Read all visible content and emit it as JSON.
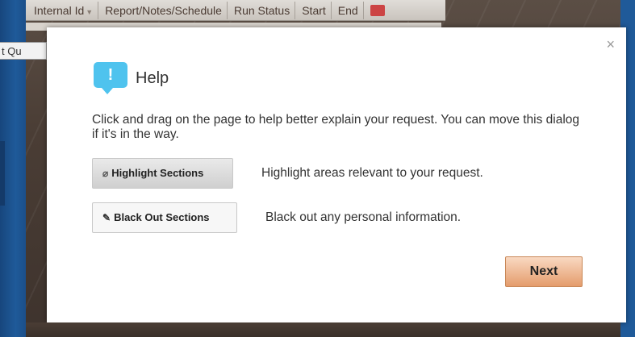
{
  "background": {
    "toolbar_columns": [
      {
        "label": "Internal Id",
        "has_arrow": true
      },
      {
        "label": "Report/Notes/Schedule",
        "has_arrow": false
      },
      {
        "label": "Run Status",
        "has_arrow": false
      },
      {
        "label": "Start",
        "has_arrow": false
      },
      {
        "label": "End",
        "has_arrow": false
      }
    ],
    "left_tab_label": "t Qu"
  },
  "dialog": {
    "close_symbol": "×",
    "icon_symbol": "!",
    "title": "Help",
    "description": "Click and drag on the page to help better explain your request. You can move this dialog if it's in the way.",
    "actions": [
      {
        "button_label": "Highlight Sections",
        "button_icon": "eraser-icon",
        "glyph": "⌀",
        "text": "Highlight areas relevant to your request."
      },
      {
        "button_label": "Black Out Sections",
        "button_icon": "pencil-icon",
        "glyph": "✎",
        "text": "Black out any personal information."
      }
    ],
    "next_label": "Next"
  },
  "colors": {
    "help_icon": "#4fc3ee",
    "next_button": "#e49c6c",
    "page_background": "#1d4f86"
  }
}
